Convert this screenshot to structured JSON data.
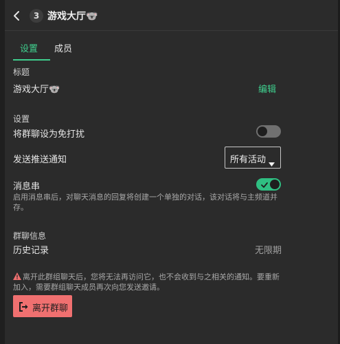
{
  "header": {
    "count": "3",
    "title": "游戏大厅🐨"
  },
  "tabs": [
    {
      "label": "设置",
      "active": true
    },
    {
      "label": "成员",
      "active": false
    }
  ],
  "title_section": {
    "label": "标题",
    "value": "游戏大厅🐨",
    "edit_label": "编辑"
  },
  "settings_section": {
    "label": "设置",
    "mute": {
      "label": "将群聊设为免打扰",
      "enabled": false
    },
    "push": {
      "label": "发送推送通知",
      "selected": "所有活动"
    },
    "threads": {
      "label": "消息串",
      "enabled": true,
      "description": "启用消息串后，对聊天消息的回复将创建一个单独的对话，该对话将与主频道并存。"
    }
  },
  "info_section": {
    "label": "群聊信息",
    "history_label": "历史记录",
    "history_value": "无限期"
  },
  "warning": "离开此群组聊天后，您将无法再访问它，也不会收到与之相关的通知。要重新加入，需要群组聊天成员再次向您发送邀请。",
  "leave_button": "离开群聊",
  "colors": {
    "accent": "#3fcf8e",
    "danger": "#f07070",
    "warning_icon": "#f07070",
    "background": "#2b2b2b"
  }
}
